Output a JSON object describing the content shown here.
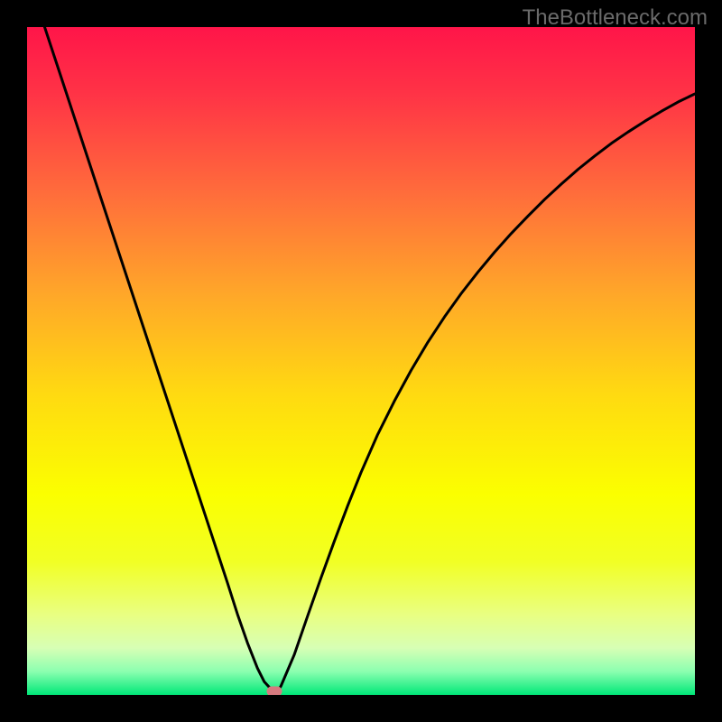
{
  "watermark": "TheBottleneck.com",
  "chart_data": {
    "type": "line",
    "title": "",
    "xlabel": "",
    "ylabel": "",
    "xlim": [
      0,
      100
    ],
    "ylim": [
      0,
      100
    ],
    "grid": false,
    "legend": false,
    "background": {
      "type": "vertical-gradient",
      "stops": [
        {
          "pos": 0.0,
          "color": "#ff1549"
        },
        {
          "pos": 0.1,
          "color": "#ff3346"
        },
        {
          "pos": 0.25,
          "color": "#ff6d3b"
        },
        {
          "pos": 0.4,
          "color": "#ffa729"
        },
        {
          "pos": 0.55,
          "color": "#ffda11"
        },
        {
          "pos": 0.7,
          "color": "#fbff00"
        },
        {
          "pos": 0.8,
          "color": "#f1ff24"
        },
        {
          "pos": 0.88,
          "color": "#e9ff82"
        },
        {
          "pos": 0.93,
          "color": "#d7ffb5"
        },
        {
          "pos": 0.965,
          "color": "#8bffb0"
        },
        {
          "pos": 1.0,
          "color": "#00e778"
        }
      ]
    },
    "series": [
      {
        "name": "bottleneck-curve",
        "color": "#000000",
        "stroke_width": 3,
        "x": [
          0.0,
          2.5,
          5.0,
          7.5,
          10.0,
          12.5,
          15.0,
          17.5,
          20.0,
          22.5,
          25.0,
          27.5,
          30.0,
          31.5,
          33.0,
          34.5,
          35.5,
          36.5,
          37.5,
          38.0,
          40.0,
          42.0,
          44.0,
          46.0,
          48.0,
          50.0,
          52.5,
          55.0,
          57.5,
          60.0,
          62.5,
          65.0,
          67.5,
          70.0,
          72.5,
          75.0,
          77.5,
          80.0,
          82.5,
          85.0,
          87.5,
          90.0,
          92.5,
          95.0,
          97.5,
          100.0
        ],
        "values": [
          108.0,
          100.4,
          92.8,
          85.2,
          77.6,
          70.0,
          62.4,
          54.8,
          47.2,
          39.6,
          32.0,
          24.4,
          16.8,
          12.1,
          7.8,
          4.0,
          2.0,
          0.9,
          0.6,
          1.3,
          6.0,
          11.8,
          17.5,
          23.0,
          28.3,
          33.3,
          39.0,
          44.0,
          48.6,
          52.8,
          56.6,
          60.1,
          63.3,
          66.3,
          69.1,
          71.7,
          74.2,
          76.5,
          78.7,
          80.7,
          82.6,
          84.3,
          85.9,
          87.4,
          88.8,
          90.0
        ]
      }
    ],
    "markers": [
      {
        "name": "optimal-point",
        "x": 37.0,
        "y": 0.6,
        "color": "#d67a7f"
      }
    ]
  }
}
